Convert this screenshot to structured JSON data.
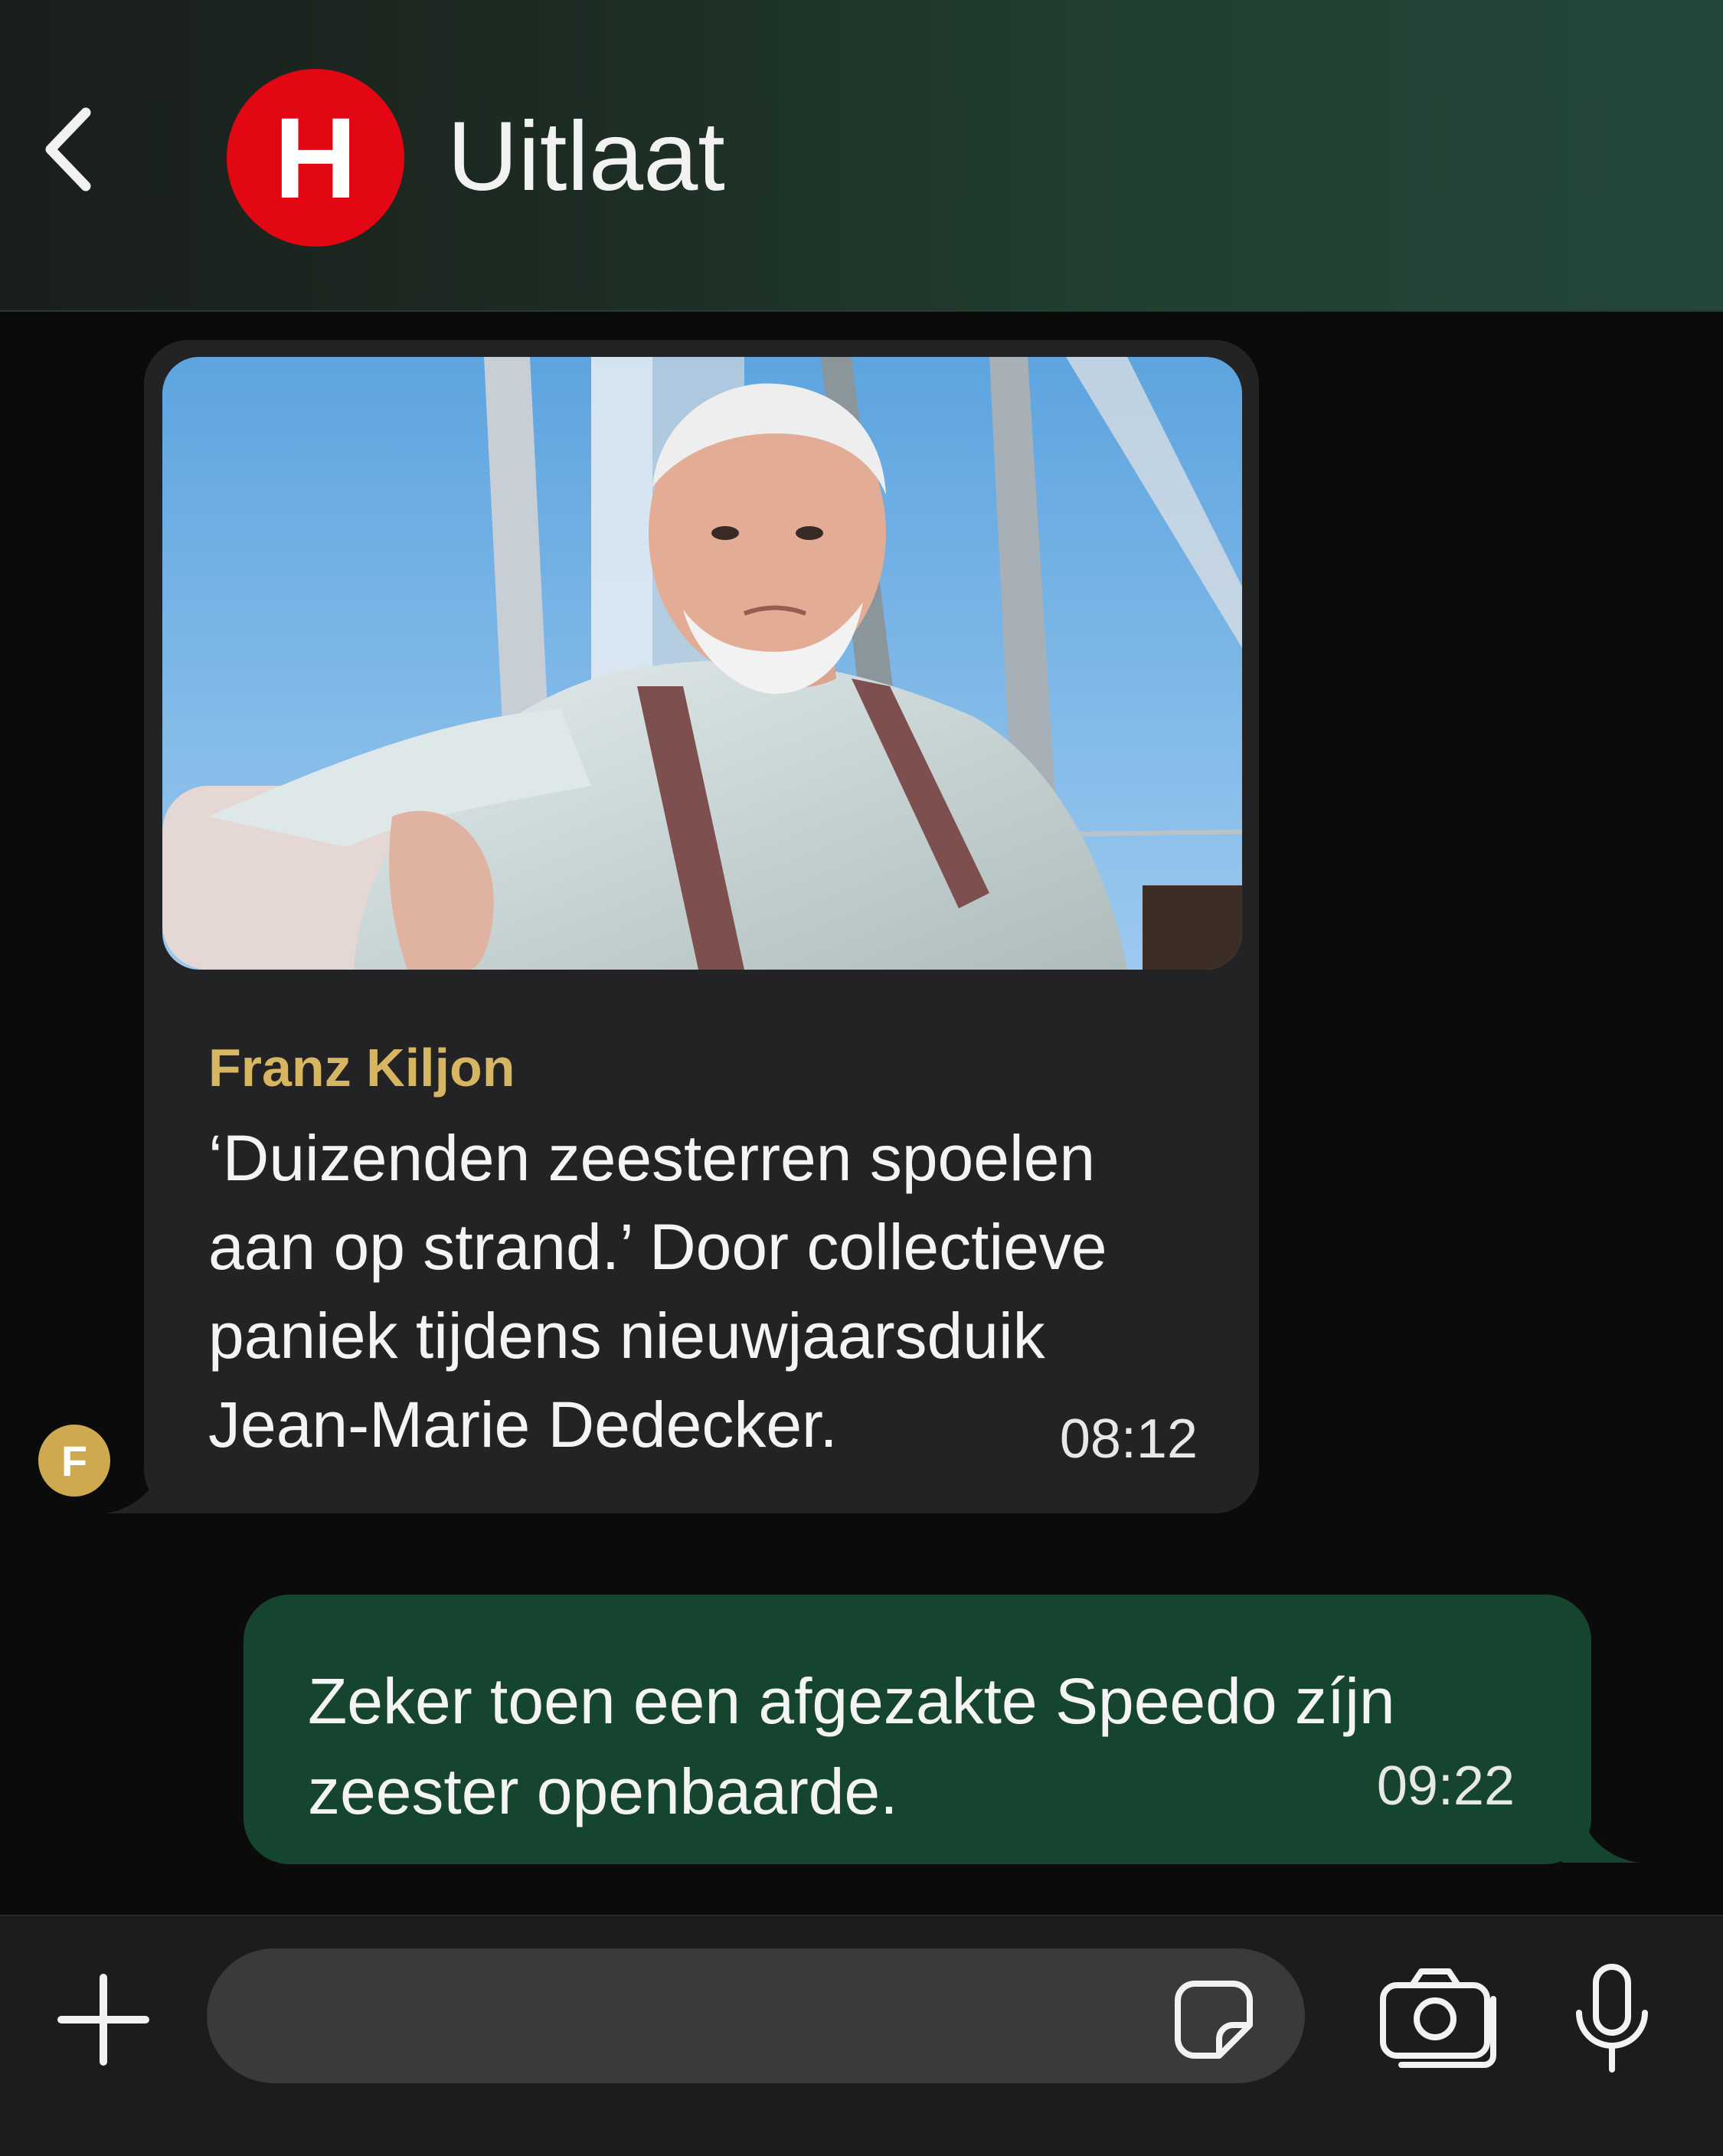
{
  "header": {
    "back_icon": "chevron-left-icon",
    "logo_letter": "H",
    "logo_color": "#e30613",
    "title": "Uitlaat"
  },
  "messages": [
    {
      "direction": "incoming",
      "has_photo": true,
      "sender": "Franz Kiljon",
      "sender_initial": "F",
      "sender_color": "#d6b660",
      "text": "‘Duizenden zeesterren spoelen\naan op strand.’ Door collectieve\npaniek tijdens nieuwjaarsduik\nJean-Marie Dedecker.",
      "time": "08:12"
    },
    {
      "direction": "outgoing",
      "text": "Zeker toen een afgezakte Speedo zíjn\nzeester openbaarde.",
      "time": "09:22"
    }
  ],
  "composer": {
    "plus_icon": "plus-icon",
    "input_value": "",
    "input_placeholder": "",
    "sticker_icon": "sticker-icon",
    "camera_icon": "camera-icon",
    "mic_icon": "microphone-icon"
  },
  "colors": {
    "incoming_bubble": "#232326",
    "outgoing_bubble": "#15452f",
    "accent_gold": "#d6b660"
  }
}
